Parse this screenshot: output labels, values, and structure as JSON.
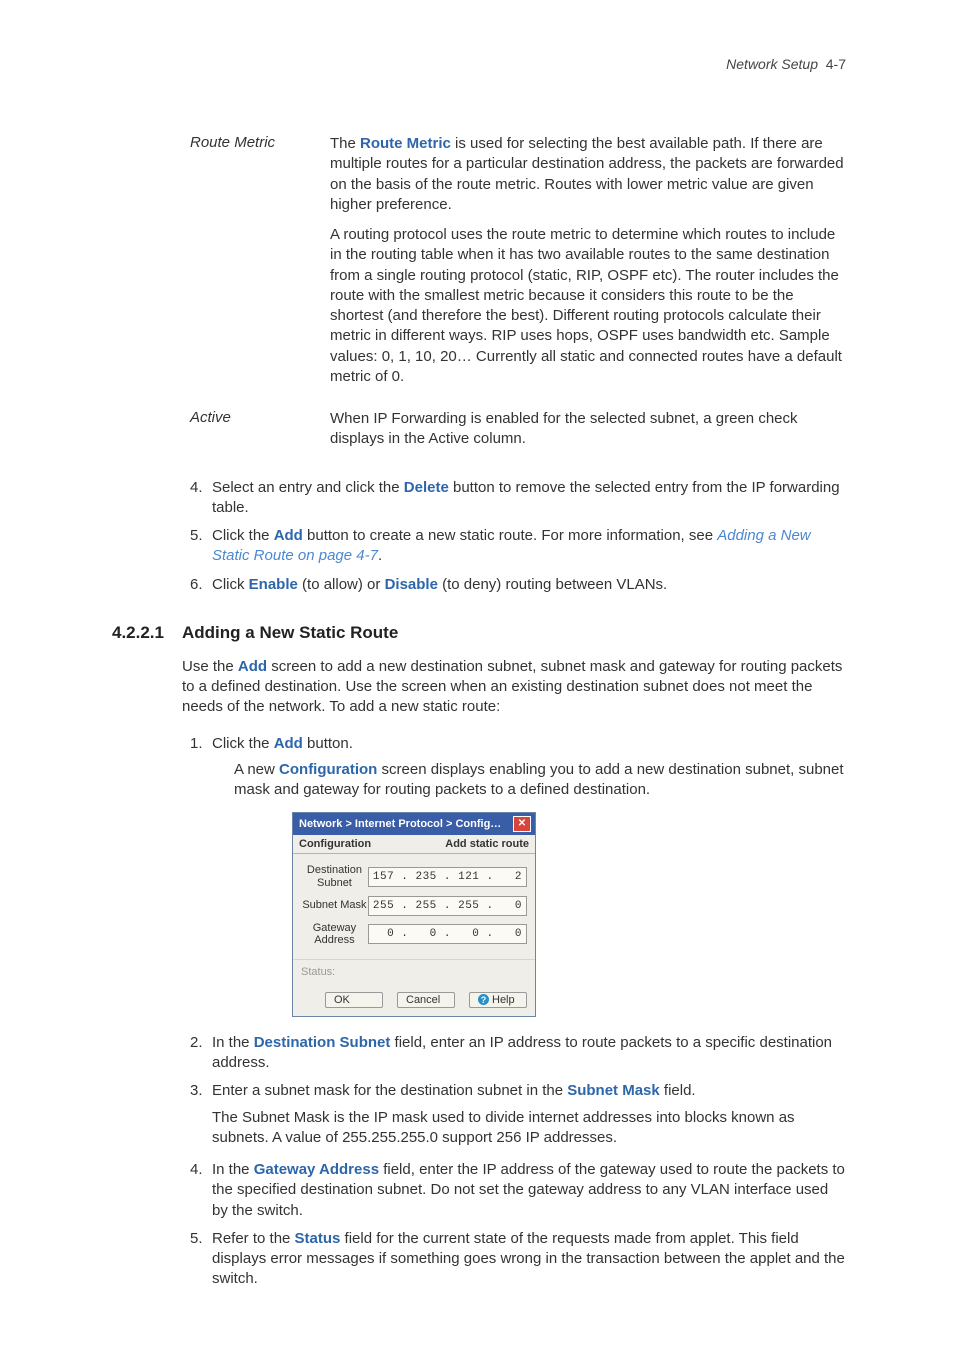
{
  "header": {
    "section": "Network Setup",
    "page": "4-7"
  },
  "definitions": {
    "routeMetric": {
      "term": "Route Metric",
      "p1_a": "The ",
      "p1_bold": "Route Metric",
      "p1_b": " is used for selecting the best available path. If there are multiple routes for a particular destination address, the packets are forwarded on the basis of the route metric. Routes with lower metric value are given higher preference.",
      "p2": "A routing protocol uses the route metric to determine which routes to include in the routing table when it has two available routes to the same destination from a single routing protocol (static, RIP, OSPF etc). The router includes the route with the smallest metric because it considers this route to be the shortest (and therefore the best). Different routing protocols calculate their metric in different ways. RIP uses hops, OSPF uses bandwidth etc. Sample values: 0, 1, 10, 20… Currently all static and connected routes have a default metric of 0."
    },
    "active": {
      "term": "Active",
      "desc": "When IP Forwarding is enabled for the selected subnet, a green check displays in the Active column."
    }
  },
  "steps_a": {
    "s4_a": "Select an entry and click the ",
    "s4_bold": "Delete",
    "s4_b": " button to remove the selected entry from the IP forwarding table.",
    "s5_a": "Click the ",
    "s5_bold": "Add",
    "s5_b": " button to create a new static route. For more information, see ",
    "s5_link": "Adding a New Static Route on page 4-7",
    "s5_c": ".",
    "s6_a": "Click ",
    "s6_bold1": "Enable",
    "s6_b": " (to allow) or ",
    "s6_bold2": "Disable",
    "s6_c": " (to deny) routing between VLANs."
  },
  "section": {
    "number": "4.2.2.1",
    "title": "Adding a New Static Route",
    "intro_a": "Use the ",
    "intro_bold": "Add",
    "intro_b": " screen to add a new destination subnet, subnet mask and gateway for routing packets to a defined destination. Use the screen when an existing destination subnet does not meet the needs of the network. To add a new static route:"
  },
  "steps_b": {
    "s1_a": "Click the ",
    "s1_bold": "Add",
    "s1_b": " button.",
    "s1_sub_a": "A new ",
    "s1_sub_bold": "Configuration",
    "s1_sub_b": " screen displays enabling you to add a new destination subnet, subnet mask and gateway for routing packets to a defined destination."
  },
  "dialog": {
    "title": "Network > Internet Protocol > Config…",
    "header_left": "Configuration",
    "header_right": "Add static route",
    "rows": {
      "dest": {
        "label": "Destination Subnet",
        "ip": "157 . 235 . 121 .   2"
      },
      "mask": {
        "label": "Subnet Mask",
        "ip": "255 . 255 . 255 .   0"
      },
      "gw": {
        "label": "Gateway Address",
        "ip": "  0 .   0 .   0 .   0"
      }
    },
    "status": "Status:",
    "buttons": {
      "ok": "OK",
      "cancel": "Cancel",
      "help": "Help"
    }
  },
  "steps_c": {
    "s2_a": "In the ",
    "s2_bold": "Destination Subnet",
    "s2_b": " field, enter an IP address to route packets to a specific destination address.",
    "s3_a": "Enter a subnet mask for the destination subnet in the ",
    "s3_bold": "Subnet Mask",
    "s3_b": " field.",
    "s3_sub": "The Subnet Mask is the IP mask used to divide internet addresses into blocks known as subnets. A value of 255.255.255.0 support 256 IP addresses.",
    "s4_a": "In the ",
    "s4_bold": "Gateway Address",
    "s4_b": " field, enter the IP address of the gateway used to route the packets to the specified destination subnet. Do not set the gateway address to any VLAN interface used by the switch.",
    "s5_a": "Refer to the ",
    "s5_bold": "Status",
    "s5_b": " field for the current state of the requests made from applet. This field displays error messages if something goes wrong in the transaction between the applet and the switch."
  }
}
